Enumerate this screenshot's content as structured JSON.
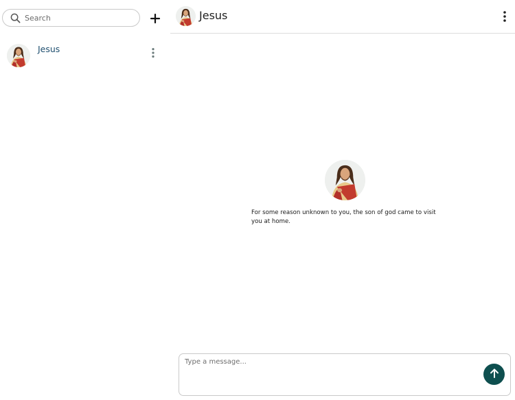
{
  "colors": {
    "accent": "#0e4f4f",
    "contact_name": "#1e4e6e",
    "border": "#c9c9c9",
    "divider": "#dcdcdc"
  },
  "sidebar": {
    "search": {
      "placeholder": "Search",
      "value": "",
      "icon": "search-icon"
    },
    "add_icon": "plus-icon",
    "contacts": [
      {
        "name": "Jesus",
        "avatar": "jesus-portrait-avatar",
        "menu_icon": "vertical-dots-icon"
      }
    ]
  },
  "chat": {
    "header": {
      "title": "Jesus",
      "avatar": "jesus-portrait-avatar",
      "menu_icon": "vertical-dots-icon"
    },
    "intro": {
      "avatar": "jesus-portrait-avatar",
      "text": "For some reason unknown to you, the son of god came to visit you at home."
    },
    "composer": {
      "placeholder": "Type a message...",
      "value": "",
      "send_icon": "arrow-up-icon"
    }
  }
}
